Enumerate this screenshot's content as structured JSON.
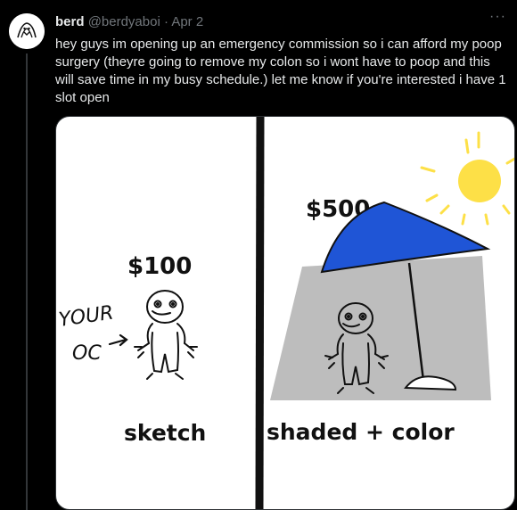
{
  "tweet": {
    "display_name": "berd",
    "handle": "@berdyaboi",
    "separator": " · ",
    "date": "Apr 2",
    "more_icon": "more-horizontal-icon",
    "text": "hey guys im opening up an emergency commission so i can afford my poop surgery (theyre going to remove my colon so i wont have to poop and this will save time in my busy schedule.) let me know if you're interested i have 1 slot open"
  },
  "image": {
    "left_panel": {
      "price": "$100",
      "annotation_line1": "YOUR",
      "annotation_line2": "OC",
      "caption": "sketch"
    },
    "right_panel": {
      "price": "$500",
      "caption": "shaded + color"
    },
    "colors": {
      "umbrella": "#1f55d6",
      "sun": "#fde047",
      "shade": "#bdbdbd"
    }
  }
}
